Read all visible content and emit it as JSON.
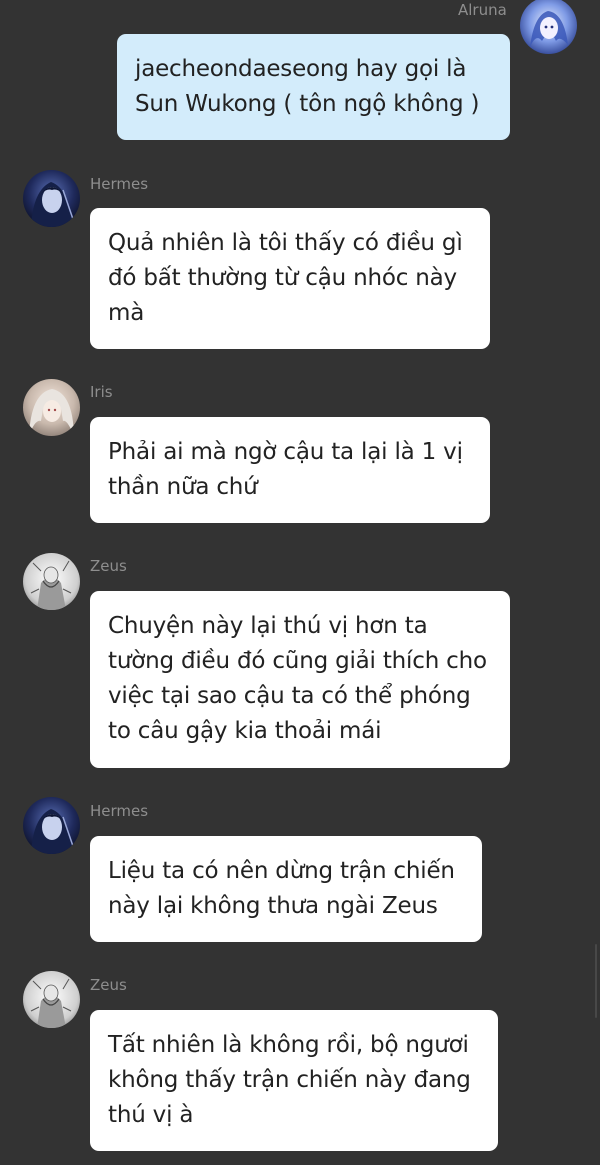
{
  "messages": [
    {
      "sender": "Alruna",
      "side": "right",
      "avatar": "alruna-avatar",
      "lines": [
        "jaecheondaeseong hay gọi là",
        "Sun Wukong ( tôn ngộ không )"
      ]
    },
    {
      "sender": "Hermes",
      "side": "left",
      "avatar": "hermes-avatar",
      "lines": [
        "Quả nhiên là tôi thấy có điều gì",
        "đó bất thường từ cậu nhóc này",
        "mà"
      ]
    },
    {
      "sender": "Iris",
      "side": "left",
      "avatar": "iris-avatar",
      "lines": [
        "Phải ai mà ngờ cậu ta lại là 1 vị",
        "thần nữa chứ"
      ]
    },
    {
      "sender": "Zeus",
      "side": "left",
      "avatar": "zeus-avatar",
      "lines": [
        "Chuyện này lại thú vị hơn ta",
        "tường điều đó cũng giải thích cho",
        "việc tại sao cậu ta có thể phóng",
        "to câu gậy kia thoải mái"
      ]
    },
    {
      "sender": "Hermes",
      "side": "left",
      "avatar": "hermes-avatar",
      "lines": [
        "Liệu ta có nên dừng trận chiến",
        "này lại không thưa ngài Zeus"
      ]
    },
    {
      "sender": "Zeus",
      "side": "left",
      "avatar": "zeus-avatar",
      "lines": [
        "Tất nhiên là không rồi, bộ ngươi",
        "không thấy trận chiến này đang",
        "thú vị à"
      ]
    }
  ],
  "colors": {
    "background": "#333333",
    "bubble_user": "#d3ecfb",
    "bubble_other": "#ffffff",
    "sender_name": "#8e8e8e"
  }
}
